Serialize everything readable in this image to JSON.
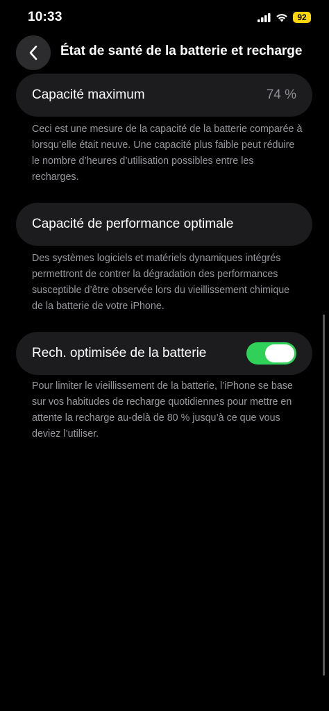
{
  "status_bar": {
    "time": "10:33",
    "battery_level": "92",
    "icons": [
      "cellular-signal-icon",
      "wifi-icon",
      "battery-icon"
    ],
    "battery_color": "#ffd60a"
  },
  "nav": {
    "back_icon": "chevron-left-icon",
    "title": "État de santé de la batterie et recharge"
  },
  "max_capacity": {
    "label": "Capacité maximum",
    "value": "74 %",
    "footnote": "Ceci est une mesure de la capacité de la batterie comparée à lorsqu’elle était neuve. Une capacité plus faible peut réduire le nombre d’heures d’utilisation possibles entre les recharges."
  },
  "performance": {
    "label": "Capacité de performance optimale",
    "footnote": "Des systèmes logiciels et matériels dynamiques intégrés permettront de contrer la dégradation des performances susceptible d’être observée lors du vieillissement chimique de la batterie de votre iPhone."
  },
  "optimized_charging": {
    "label": "Rech. optimisée de la batterie",
    "enabled": true,
    "toggle_color": "#30d158",
    "footnote": "Pour limiter le vieillissement de la batterie, l’iPhone se base sur vos habitudes de recharge quotidiennes pour mettre en attente la recharge au-delà de 80 % jusqu’à ce que vous deviez l’utiliser."
  }
}
